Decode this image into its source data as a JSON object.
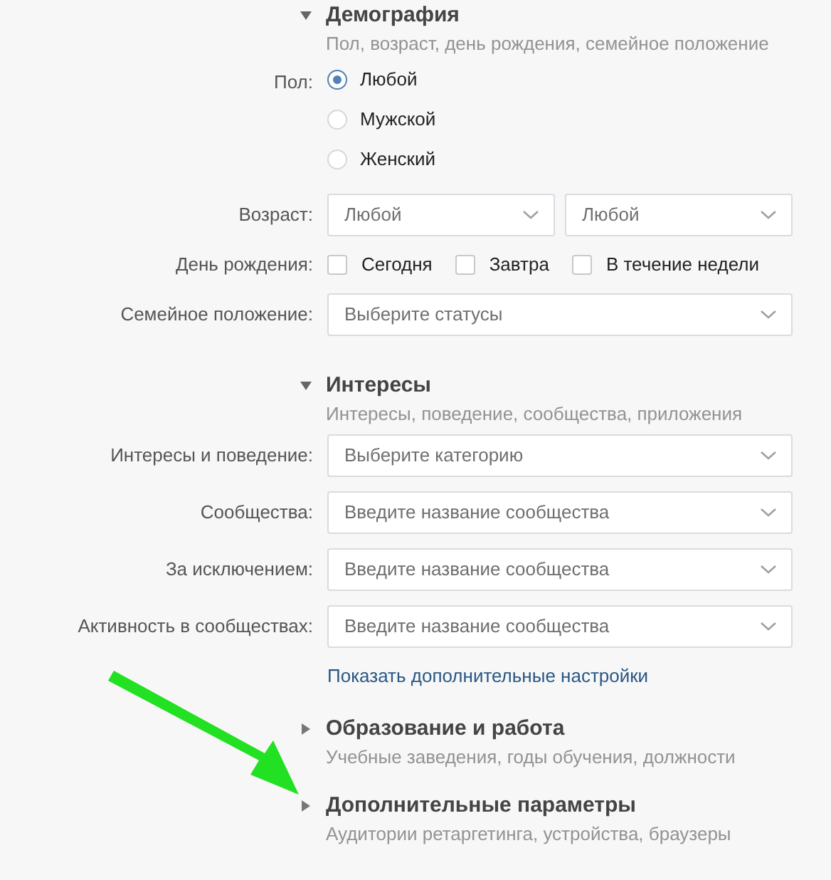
{
  "sections": [
    {
      "title": "Демография",
      "subtitle": "Пол, возраст, день рождения, семейное положение",
      "expanded": true,
      "rows": [
        {
          "kind": "radio",
          "label": "Пол:",
          "options": [
            {
              "label": "Любой",
              "selected": true
            },
            {
              "label": "Мужской",
              "selected": false
            },
            {
              "label": "Женский",
              "selected": false
            }
          ]
        },
        {
          "kind": "range",
          "label": "Возраст:",
          "selects": [
            {
              "value": "Любой"
            },
            {
              "value": "Любой"
            }
          ]
        },
        {
          "kind": "checkboxes",
          "label": "День рождения:",
          "options": [
            {
              "label": "Сегодня",
              "checked": false
            },
            {
              "label": "Завтра",
              "checked": false
            },
            {
              "label": "В течение недели",
              "checked": false
            }
          ]
        },
        {
          "kind": "select",
          "label": "Семейное положение:",
          "placeholder": "Выберите статусы"
        }
      ]
    },
    {
      "title": "Интересы",
      "subtitle": "Интересы, поведение, сообщества, приложения",
      "expanded": true,
      "rows": [
        {
          "kind": "select",
          "label": "Интересы и поведение:",
          "placeholder": "Выберите категорию"
        },
        {
          "kind": "select",
          "label": "Сообщества:",
          "placeholder": "Введите название сообщества"
        },
        {
          "kind": "select",
          "label": "За исключением:",
          "placeholder": "Введите название сообщества"
        },
        {
          "kind": "select",
          "label": "Активность в сообществах:",
          "placeholder": "Введите название сообщества"
        },
        {
          "kind": "link",
          "text": "Показать дополнительные настройки"
        }
      ]
    },
    {
      "title": "Образование и работа",
      "subtitle": "Учебные заведения, годы обучения, должности",
      "expanded": false
    },
    {
      "title": "Дополнительные параметры",
      "subtitle": "Аудитории ретаргетинга, устройства, браузеры",
      "expanded": false
    }
  ]
}
